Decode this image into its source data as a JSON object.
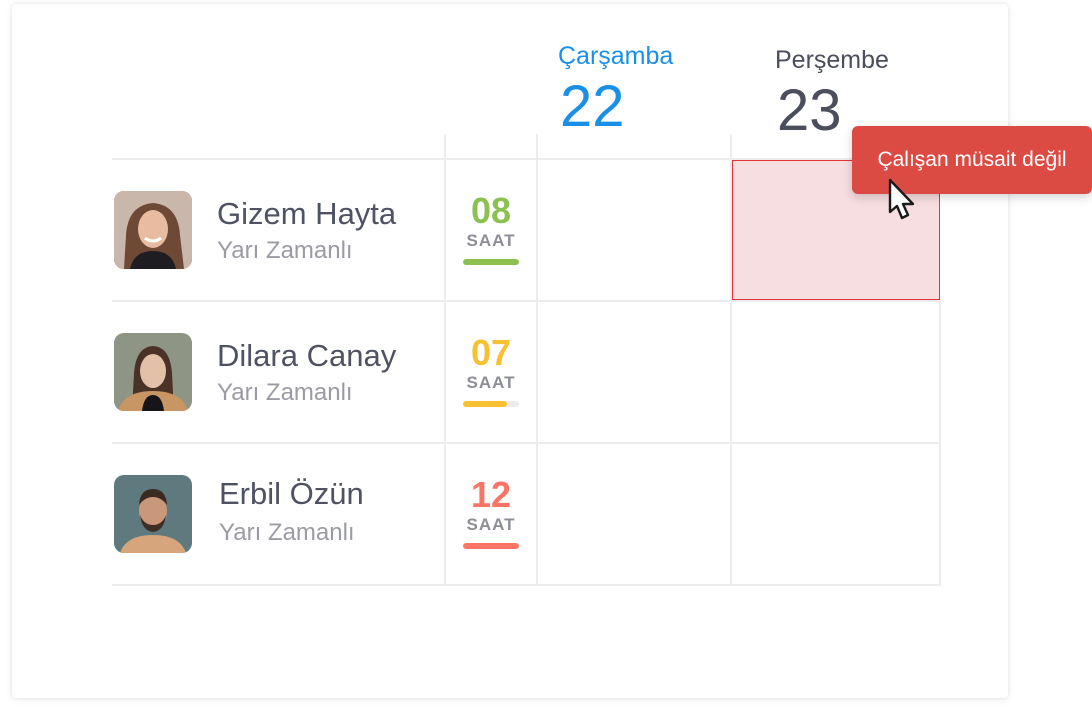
{
  "days": [
    {
      "name": "Çarşamba",
      "date": "22",
      "color": "#1a8fe8"
    },
    {
      "name": "Perşembe",
      "date": "23",
      "color": "#4b4e5c"
    }
  ],
  "employees": [
    {
      "name": "Gizem Hayta",
      "role": "Yarı Zamanlı",
      "hours": "08",
      "hours_unit": "SAAT",
      "accent": "#8cc152",
      "bar_fill_percent": 100,
      "avatar": "woman-smiling-long-hair"
    },
    {
      "name": "Dilara Canay",
      "role": "Yarı Zamanlı",
      "hours": "07",
      "hours_unit": "SAAT",
      "accent": "#f8c132",
      "bar_fill_percent": 78,
      "avatar": "woman-short-hair"
    },
    {
      "name": "Erbil Özün",
      "role": "Yarı Zamanlı",
      "hours": "12",
      "hours_unit": "SAAT",
      "accent": "#fa7566",
      "bar_fill_percent": 100,
      "avatar": "bearded-man"
    }
  ],
  "unavailable_cell": {
    "employee": "Gizem Hayta",
    "day": "Perşembe",
    "color": "#f7dee0",
    "border_color": "#e0343a"
  },
  "tooltip": {
    "text": "Çalışan müsait değil",
    "color": "#dc4b43"
  },
  "cursor_icon": "hand-pointer-icon"
}
